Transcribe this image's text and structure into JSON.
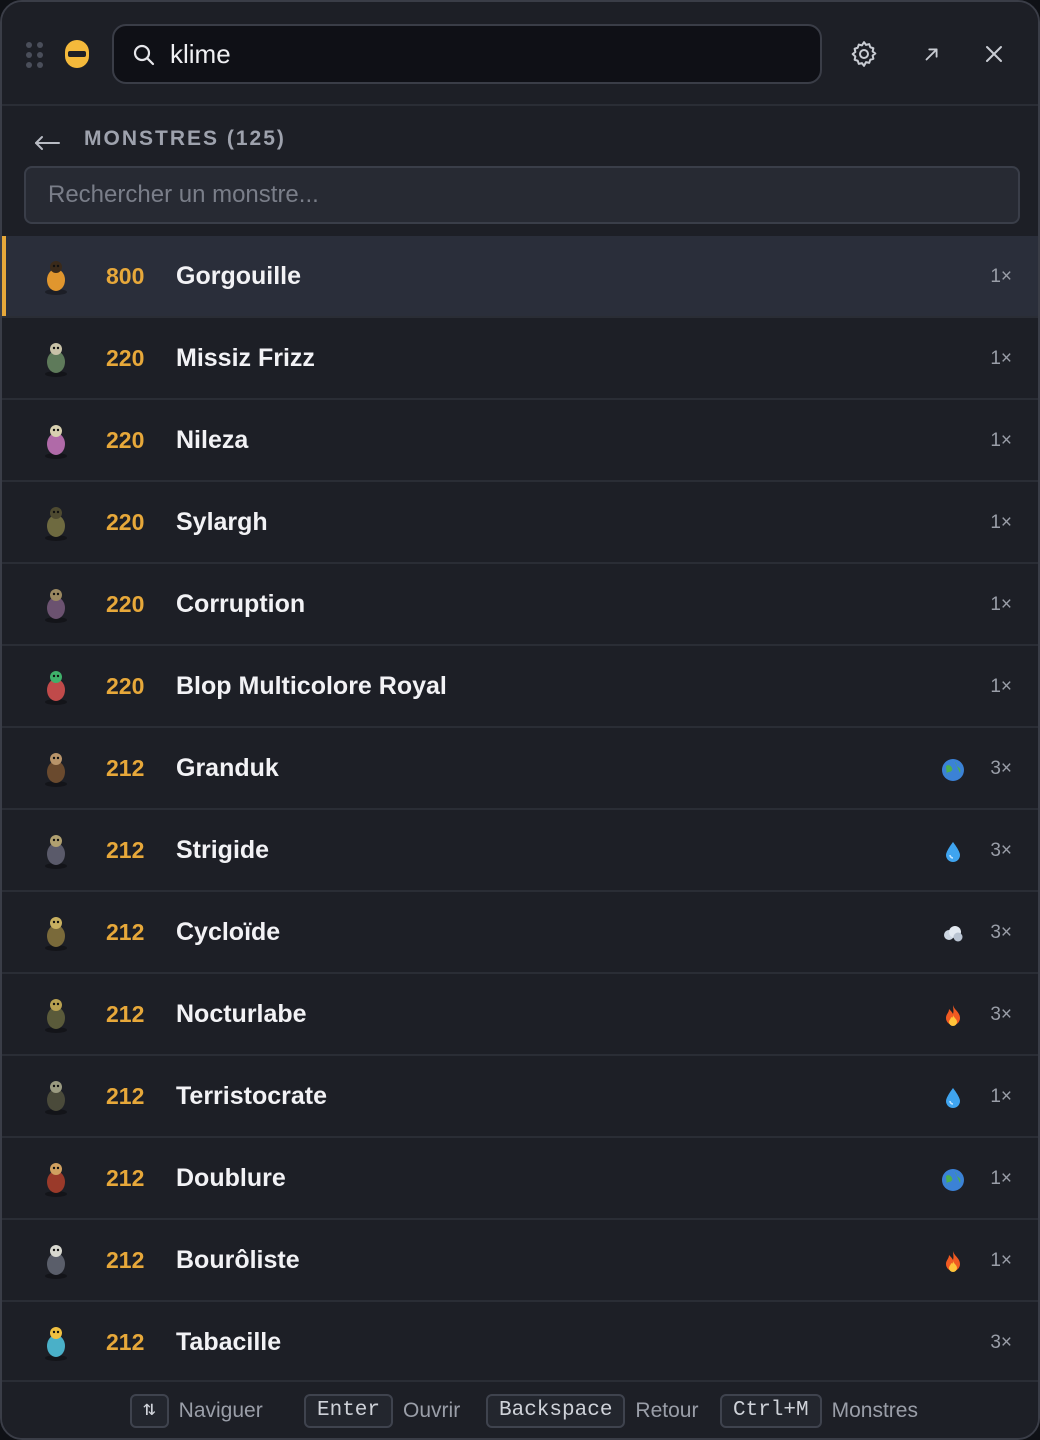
{
  "search": {
    "value": "klime"
  },
  "header": {
    "title": "MONSTRES (125)"
  },
  "filter": {
    "placeholder": "Rechercher un monstre..."
  },
  "monsters": [
    {
      "level": "800",
      "name": "Gorgouille",
      "count": "1×",
      "element": null,
      "selected": true
    },
    {
      "level": "220",
      "name": "Missiz Frizz",
      "count": "1×",
      "element": null
    },
    {
      "level": "220",
      "name": "Nileza",
      "count": "1×",
      "element": null
    },
    {
      "level": "220",
      "name": "Sylargh",
      "count": "1×",
      "element": null
    },
    {
      "level": "220",
      "name": "Corruption",
      "count": "1×",
      "element": null
    },
    {
      "level": "220",
      "name": "Blop Multicolore Royal",
      "count": "1×",
      "element": null
    },
    {
      "level": "212",
      "name": "Granduk",
      "count": "3×",
      "element": "earth-globe-icon"
    },
    {
      "level": "212",
      "name": "Strigide",
      "count": "3×",
      "element": "water-drop-icon"
    },
    {
      "level": "212",
      "name": "Cycloïde",
      "count": "3×",
      "element": "air-cloud-icon"
    },
    {
      "level": "212",
      "name": "Nocturlabe",
      "count": "3×",
      "element": "fire-flame-icon"
    },
    {
      "level": "212",
      "name": "Terristocrate",
      "count": "1×",
      "element": "water-drop-icon"
    },
    {
      "level": "212",
      "name": "Doublure",
      "count": "1×",
      "element": "earth-globe-icon"
    },
    {
      "level": "212",
      "name": "Bourôliste",
      "count": "1×",
      "element": "fire-flame-icon"
    },
    {
      "level": "212",
      "name": "Tabacille",
      "count": "3×",
      "element": null
    }
  ],
  "footer": {
    "hints": [
      {
        "key": "⇅",
        "label": "Naviguer"
      },
      {
        "key": "Enter",
        "label": "Ouvrir"
      },
      {
        "key": "Backspace",
        "label": "Retour"
      },
      {
        "key": "Ctrl+M",
        "label": "Monstres"
      }
    ]
  },
  "colors": {
    "accent": "#e7a83a",
    "background": "#1d1f26",
    "selected_row": "#2a2e3a"
  }
}
